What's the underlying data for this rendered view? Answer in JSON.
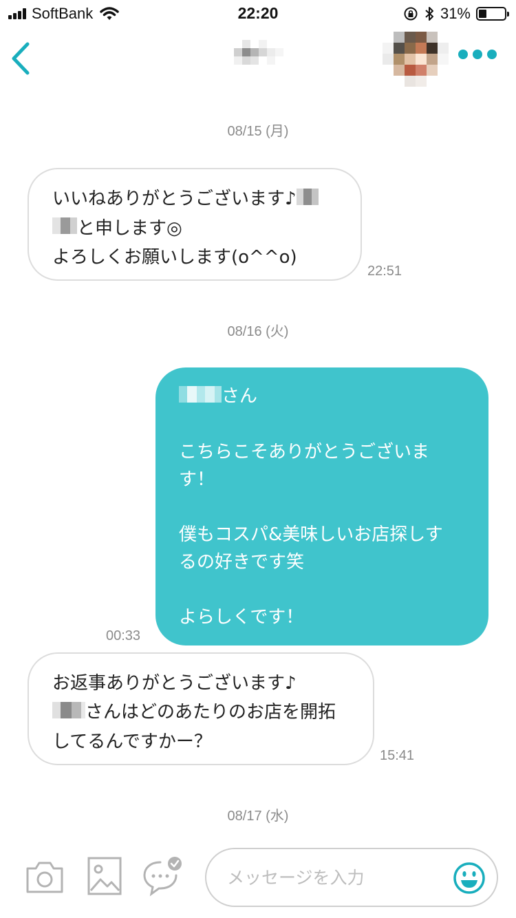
{
  "status_bar": {
    "carrier": "SoftBank",
    "time": "22:20",
    "battery": "31%",
    "battery_level": 0.31
  },
  "nav": {
    "back_icon": "chevron-left-icon",
    "more_icon": "ellipsis-icon",
    "accent_color": "#19aebd"
  },
  "messages": {
    "date1": "08/15 (月)",
    "m1": {
      "line1": "いいねありがとうございます♪",
      "line2": "と申します◎",
      "line3": "よろしくお願いします(o^^o)",
      "time": "22:51"
    },
    "date2": "08/16 (火)",
    "m2": {
      "line1": "さん",
      "line2": "こちらこそありがとうございま",
      "line3": "す！",
      "line4": "僕もコスパ&美味しいお店探しす",
      "line5": "るの好きです笑",
      "line6": "よらしくです！",
      "time": "00:33",
      "bubble_color": "#40c4cc"
    },
    "m3": {
      "line1": "お返事ありがとうございます♪",
      "line2": "さんはどのあたりのお店を開拓",
      "line3": "してるんですかー？",
      "time": "15:41"
    },
    "date3": "08/17 (水)"
  },
  "input_bar": {
    "camera_icon": "camera-icon",
    "image_icon": "image-icon",
    "chat_icon": "chat-bubble-icon",
    "placeholder": "メッセージを入力",
    "emoji_icon": "smiley-icon"
  }
}
